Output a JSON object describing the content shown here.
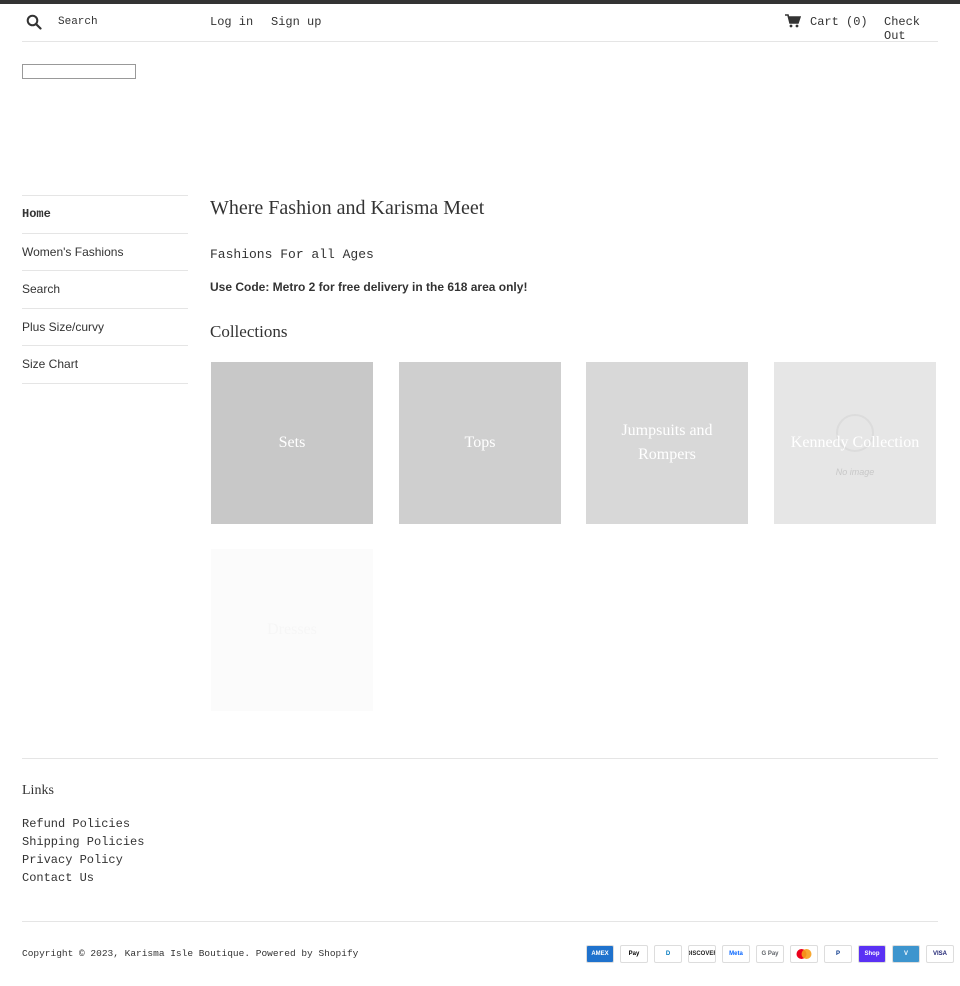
{
  "header": {
    "search_placeholder": "Search",
    "login_label": "Log in",
    "signup_label": "Sign up",
    "cart_label": "Cart (0)",
    "checkout_label": "Check Out"
  },
  "sidebar": {
    "items": [
      {
        "label": "Home",
        "active": true
      },
      {
        "label": "Women's Fashions"
      },
      {
        "label": "Search"
      },
      {
        "label": "Plus Size/curvy"
      },
      {
        "label": "Size Chart"
      }
    ]
  },
  "main": {
    "title": "Where Fashion and Karisma Meet",
    "subtitle": "Fashions For all Ages",
    "promo": "Use Code: Metro 2 for free delivery in the 618 area only!",
    "collections_title": "Collections",
    "collections": [
      {
        "label": "Sets",
        "bg": "#c8c8c8"
      },
      {
        "label": "Tops",
        "bg": "#cfcfcf"
      },
      {
        "label": "Jumpsuits and Rompers",
        "bg": "#d8d8d8"
      },
      {
        "label": "Kennedy Collection",
        "bg": "#e6e6e6",
        "placeholder": "No image"
      },
      {
        "label": "Dresses",
        "bg": "#fbfbfb"
      }
    ]
  },
  "footer": {
    "links_title": "Links",
    "links": [
      "Refund Policies",
      "Shipping Policies",
      "Privacy Policy",
      "Contact Us"
    ],
    "copyright": "Copyright © 2023, Karisma Isle Boutique. Powered by Shopify",
    "payments": [
      {
        "icon": "amex-icon",
        "text": "AMEX",
        "bg": "#1f72cd",
        "color": "#ffffff"
      },
      {
        "icon": "apple-pay-icon",
        "text": "Pay",
        "bg": "#ffffff",
        "color": "#000000"
      },
      {
        "icon": "diners-club-icon",
        "text": "D",
        "bg": "#ffffff",
        "color": "#0079be"
      },
      {
        "icon": "discover-icon",
        "text": "DISCOVER",
        "bg": "#ffffff",
        "color": "#222222"
      },
      {
        "icon": "meta-pay-icon",
        "text": "Meta",
        "bg": "#ffffff",
        "color": "#0866ff"
      },
      {
        "icon": "google-pay-icon",
        "text": "G Pay",
        "bg": "#ffffff",
        "color": "#5f6368"
      },
      {
        "icon": "mastercard-icon",
        "text": "",
        "bg": "#ffffff",
        "color": "#eb001b"
      },
      {
        "icon": "paypal-icon",
        "text": "P",
        "bg": "#ffffff",
        "color": "#003087"
      },
      {
        "icon": "shop-pay-icon",
        "text": "Shop",
        "bg": "#5a31f4",
        "color": "#ffffff"
      },
      {
        "icon": "venmo-icon",
        "text": "V",
        "bg": "#3d95ce",
        "color": "#ffffff"
      },
      {
        "icon": "visa-icon",
        "text": "VISA",
        "bg": "#ffffff",
        "color": "#1a1f71"
      }
    ]
  }
}
